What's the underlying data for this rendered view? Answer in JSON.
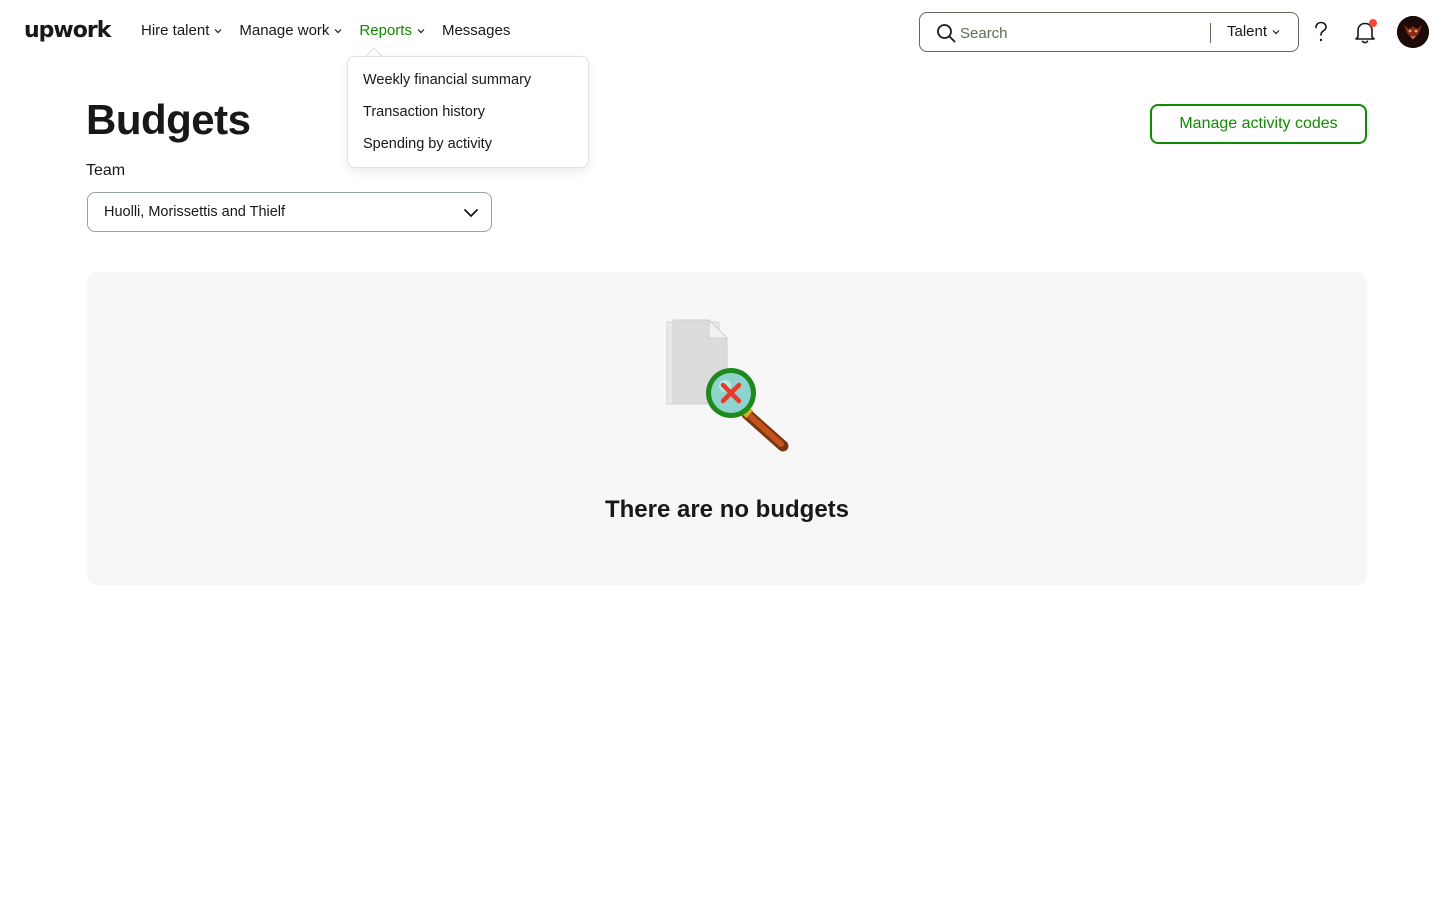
{
  "header": {
    "logo": "upwork",
    "nav": [
      {
        "label": "Hire talent",
        "has_menu": true
      },
      {
        "label": "Manage work",
        "has_menu": true
      },
      {
        "label": "Reports",
        "has_menu": true,
        "active": true
      },
      {
        "label": "Messages",
        "has_menu": false
      }
    ],
    "search": {
      "placeholder": "Search",
      "type_label": "Talent"
    },
    "icons": [
      "search-icon",
      "help-icon",
      "bell-icon",
      "avatar"
    ]
  },
  "reports_menu": {
    "items": [
      "Weekly financial summary",
      "Transaction history",
      "Spending by activity"
    ]
  },
  "main": {
    "title": "Budgets",
    "manage_button": "Manage activity codes",
    "team_label": "Team",
    "team_selected": "Huolli, Morissettis and Thielf",
    "empty_text": "There are no budgets"
  },
  "colors": {
    "brand_green": "#108a00",
    "notification": "#f6483d",
    "panel_bg": "#f7f7f7"
  }
}
